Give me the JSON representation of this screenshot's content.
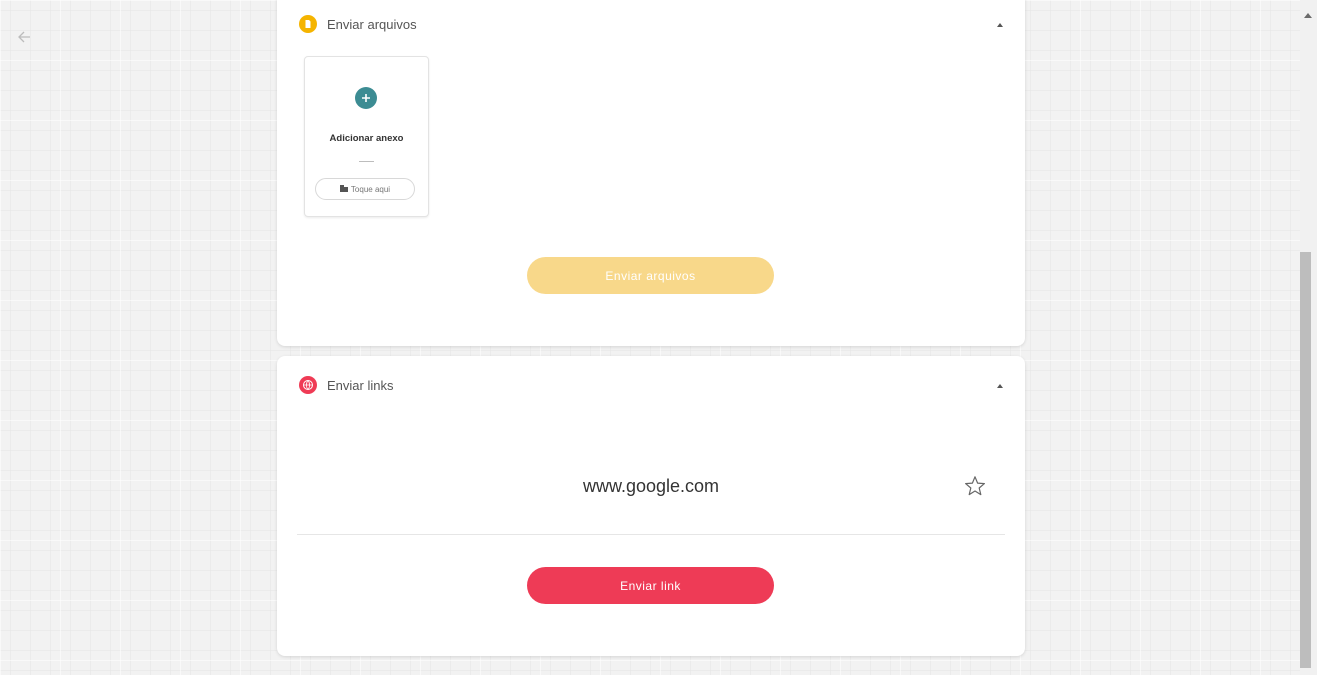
{
  "navigation": {
    "back_icon": "arrow-left-icon"
  },
  "files_section": {
    "title": "Enviar arquivos",
    "icon": "file-icon",
    "icon_color": "#f5b400",
    "collapse_icon": "caret-up-icon",
    "attachment": {
      "icon": "plus-circle-icon",
      "icon_color": "#3c8c93",
      "label": "Adicionar anexo",
      "button_label": "Toque aqui",
      "button_icon": "folder-icon"
    },
    "submit_label": "Enviar arquivos",
    "submit_color": "#f8d88a"
  },
  "links_section": {
    "title": "Enviar links",
    "icon": "globe-icon",
    "icon_color": "#ef3b55",
    "collapse_icon": "caret-up-icon",
    "link_value": "www.google.com",
    "favorite_icon": "star-outline-icon",
    "submit_label": "Enviar link",
    "submit_color": "#ee3b56"
  }
}
